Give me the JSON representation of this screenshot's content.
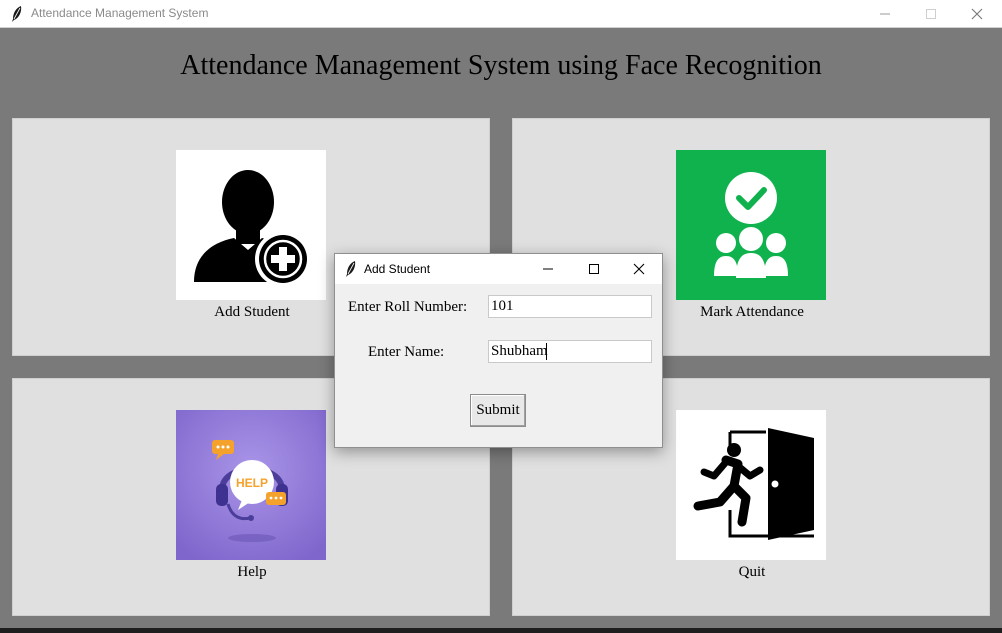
{
  "window": {
    "title": "Attendance Management System",
    "controls": [
      "minimize-icon",
      "maximize-icon",
      "close-icon"
    ]
  },
  "main": {
    "heading": "Attendance Management System using Face Recognition",
    "panels": [
      {
        "label": "Add Student",
        "icon": "add-user-icon",
        "tile_color": "#ffffff"
      },
      {
        "label": "Mark Attendance",
        "icon": "group-check-icon",
        "tile_color": "#10b24e"
      },
      {
        "label": "Help",
        "icon": "help-headset-icon",
        "tile_color": "#8f77d8",
        "image_text": "HELP"
      },
      {
        "label": "Quit",
        "icon": "exit-door-icon",
        "tile_color": "#ffffff"
      }
    ]
  },
  "dialog": {
    "title": "Add Student",
    "roll_label": "Enter Roll Number:",
    "roll_value": "101",
    "name_label": "Enter Name:",
    "name_value": "Shubham",
    "submit_label": "Submit"
  },
  "colors": {
    "background": "#7a7a7a",
    "panel": "#e0e0e0",
    "attendance_green": "#10b24e",
    "help_purple": "#8f77d8"
  }
}
